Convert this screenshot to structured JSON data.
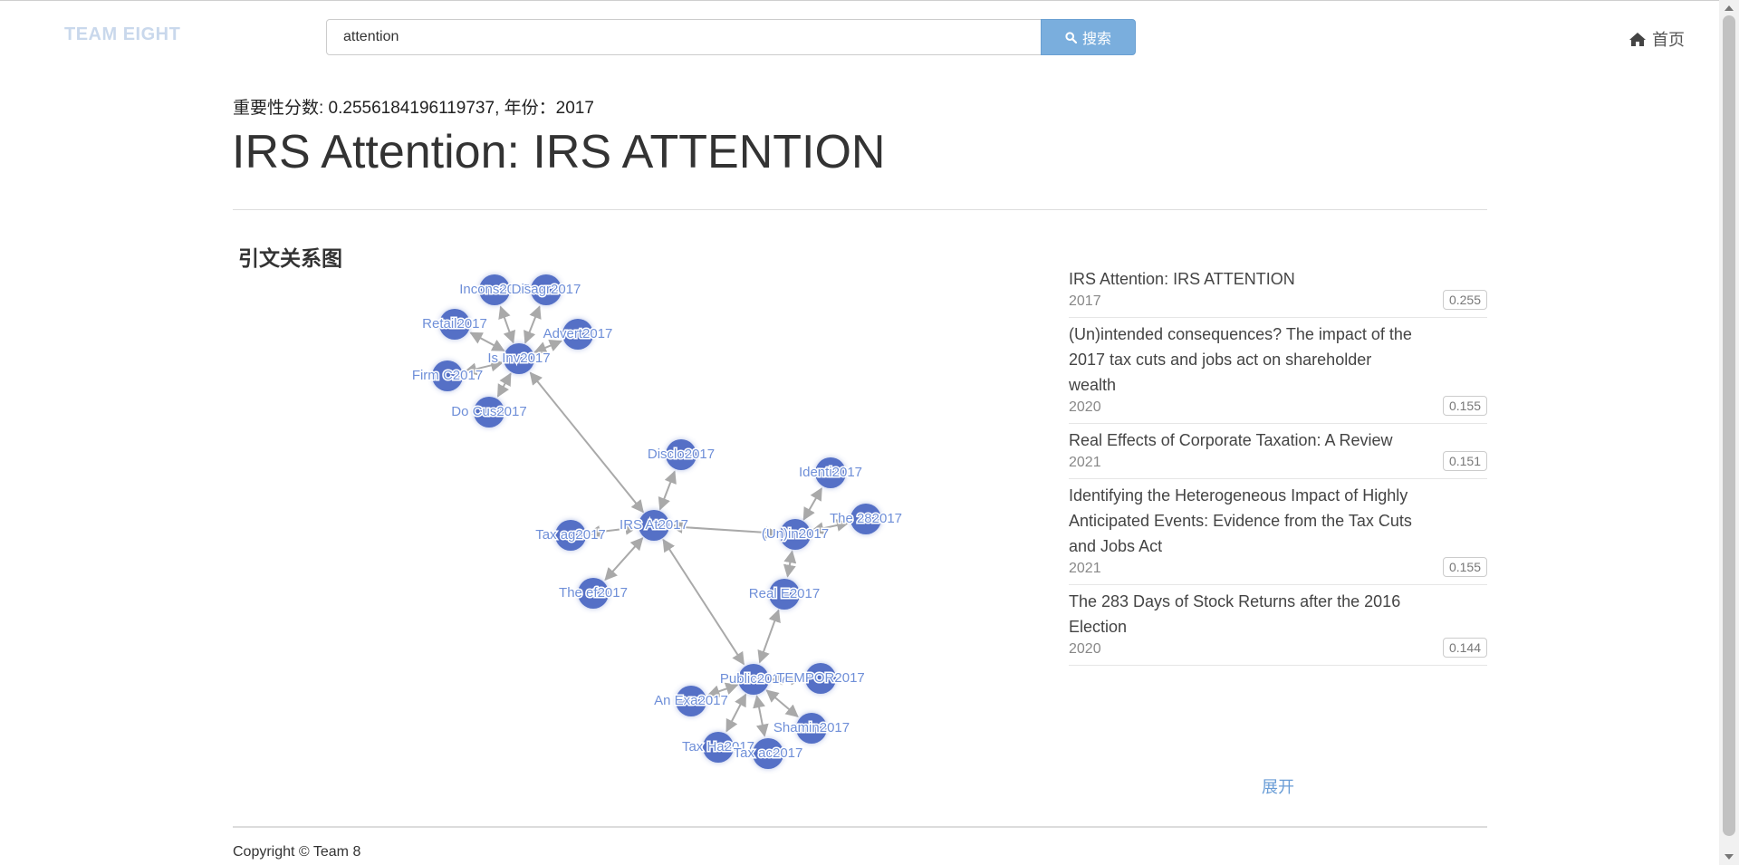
{
  "header": {
    "brand": "TEAM EIGHT",
    "search_value": "attention",
    "search_button": "搜索",
    "home_label": "首页"
  },
  "paper": {
    "meta": "重要性分数: 0.2556184196119737, 年份：2017",
    "title": "IRS Attention: IRS ATTENTION"
  },
  "graph": {
    "section_title": "引文关系图",
    "nodes": [
      {
        "id": "incons",
        "label": "Incons2017"
      },
      {
        "id": "disagr",
        "label": "Disagr2017"
      },
      {
        "id": "retail",
        "label": "Retail2017"
      },
      {
        "id": "advert",
        "label": "Advert2017"
      },
      {
        "id": "isinv",
        "label": "Is Inv2017"
      },
      {
        "id": "firmc",
        "label": "Firm C2017"
      },
      {
        "id": "docus",
        "label": "Do Cus2017"
      },
      {
        "id": "disclo",
        "label": "Disclo2017"
      },
      {
        "id": "identi",
        "label": "Identi2017"
      },
      {
        "id": "irsat",
        "label": "IRS At2017"
      },
      {
        "id": "taxag",
        "label": "Tax ag2017"
      },
      {
        "id": "unin",
        "label": "(Un)in2017"
      },
      {
        "id": "the282",
        "label": "The 282017"
      },
      {
        "id": "theef",
        "label": "The ef2017"
      },
      {
        "id": "reale",
        "label": "Real E2017"
      },
      {
        "id": "public",
        "label": "Public2017"
      },
      {
        "id": "tempor",
        "label": "TEMPOR2017"
      },
      {
        "id": "anexa",
        "label": "An Exa2017"
      },
      {
        "id": "shamin",
        "label": "Shamin2017"
      },
      {
        "id": "taxha",
        "label": "Tax Ha2017"
      },
      {
        "id": "taxac",
        "label": "Tax ac2017"
      }
    ],
    "edges": [
      [
        "isinv",
        "incons"
      ],
      [
        "isinv",
        "disagr"
      ],
      [
        "isinv",
        "retail"
      ],
      [
        "isinv",
        "advert"
      ],
      [
        "isinv",
        "firmc"
      ],
      [
        "isinv",
        "docus"
      ],
      [
        "irsat",
        "isinv"
      ],
      [
        "irsat",
        "disclo"
      ],
      [
        "irsat",
        "taxag"
      ],
      [
        "irsat",
        "theef"
      ],
      [
        "irsat",
        "unin"
      ],
      [
        "irsat",
        "public"
      ],
      [
        "unin",
        "identi"
      ],
      [
        "unin",
        "the282"
      ],
      [
        "unin",
        "reale"
      ],
      [
        "reale",
        "public"
      ],
      [
        "public",
        "tempor"
      ],
      [
        "public",
        "anexa"
      ],
      [
        "public",
        "shamin"
      ],
      [
        "public",
        "taxha"
      ],
      [
        "public",
        "taxac"
      ]
    ]
  },
  "related": [
    {
      "title": "IRS Attention: IRS ATTENTION",
      "year": "2017",
      "score": "0.255"
    },
    {
      "title": "(Un)intended consequences? The impact of the 2017 tax cuts and jobs act on shareholder wealth",
      "year": "2020",
      "score": "0.155"
    },
    {
      "title": "Real Effects of Corporate Taxation: A Review",
      "year": "2021",
      "score": "0.151"
    },
    {
      "title": "Identifying the Heterogeneous Impact of Highly Anticipated Events: Evidence from the Tax Cuts and Jobs Act",
      "year": "2021",
      "score": "0.155"
    },
    {
      "title": "The 283 Days of Stock Returns after the 2016 Election",
      "year": "2020",
      "score": "0.144"
    }
  ],
  "expand_label": "展开",
  "footer": {
    "copyright": "Copyright © Team 8"
  },
  "colors": {
    "node": "#5470c6",
    "edge": "#a9a9a9",
    "accent": "#7aaedd",
    "link": "#6a9dd6"
  }
}
